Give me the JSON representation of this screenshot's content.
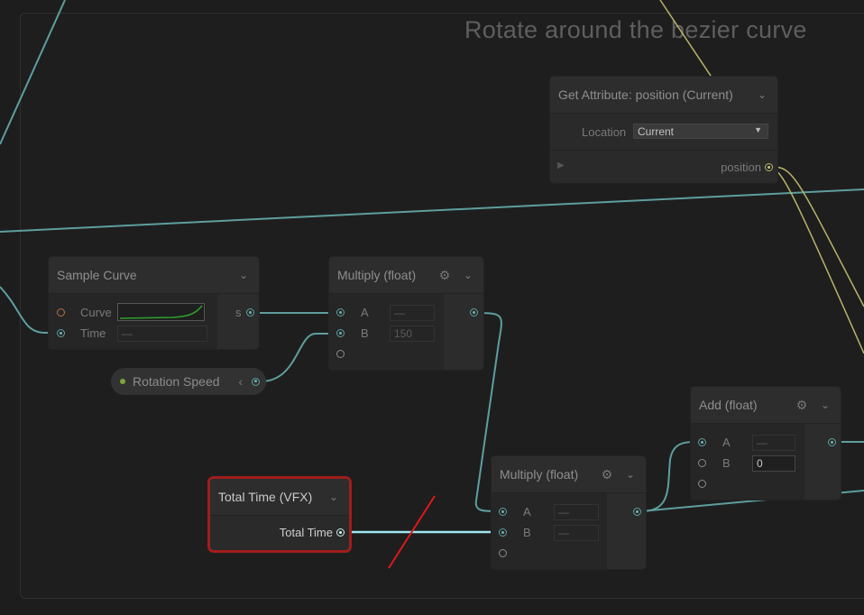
{
  "group": {
    "title": "Rotate around the bezier curve"
  },
  "nodes": {
    "get_attribute": {
      "title": "Get Attribute: position (Current)",
      "location_label": "Location",
      "location_value": "Current",
      "output_label": "position"
    },
    "sample_curve": {
      "title": "Sample Curve",
      "curve_label": "Curve",
      "time_label": "Time",
      "time_value": "—",
      "output_label": "s"
    },
    "multiply_1": {
      "title": "Multiply (float)",
      "a_label": "A",
      "a_value": "—",
      "b_label": "B",
      "b_value": "150"
    },
    "rotation_speed": {
      "label": "Rotation Speed",
      "chevron": "‹"
    },
    "add": {
      "title": "Add (float)",
      "a_label": "A",
      "a_value": "—",
      "b_label": "B",
      "b_value": "0"
    },
    "total_time": {
      "title": "Total Time (VFX)",
      "output_label": "Total Time"
    },
    "multiply_2": {
      "title": "Multiply (float)",
      "a_label": "A",
      "a_value": "—",
      "b_label": "B",
      "b_value": "—"
    }
  },
  "icons": {
    "gear": "gear-icon",
    "chevron": "chevron-down-icon",
    "play": "play-icon"
  },
  "colors": {
    "background": "#1d1d1d",
    "wire_float": "#5e9e9e",
    "wire_vector": "#b7b36a",
    "wire_highlight": "#9fe6f0",
    "selection": "#a11d1d",
    "cut_line": "#e01818"
  }
}
